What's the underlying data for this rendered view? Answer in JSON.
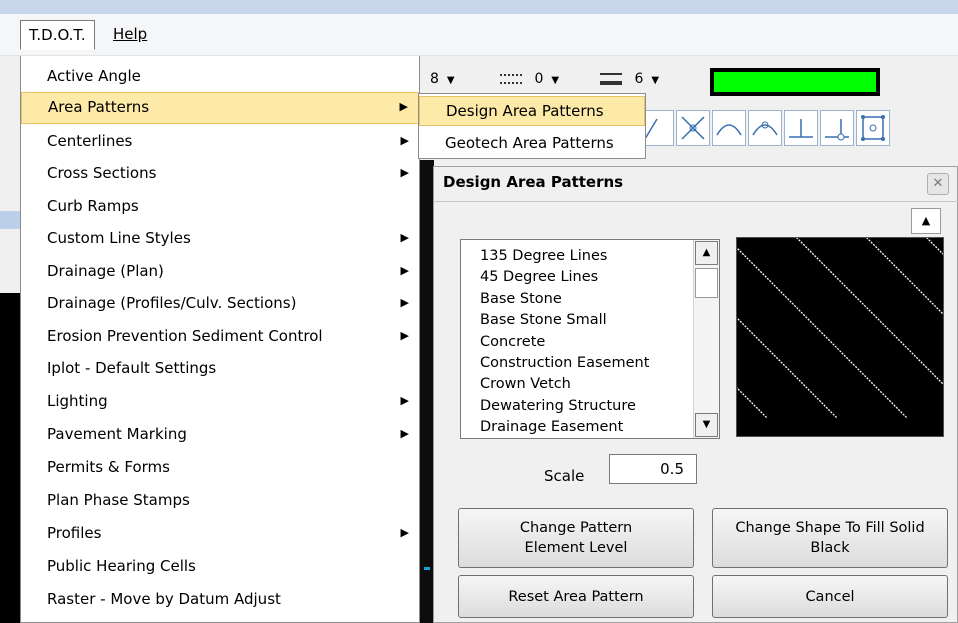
{
  "menubar": {
    "items": [
      {
        "label": "T.D.O.T."
      },
      {
        "label": "Help"
      }
    ]
  },
  "toolbar": {
    "weight_value": "8",
    "style_value": "0",
    "line_weight_value": "6",
    "active_color": "#00ff00"
  },
  "menu": {
    "items": [
      {
        "label": "Active Angle",
        "has_submenu": false
      },
      {
        "label": "Area Patterns",
        "has_submenu": true,
        "highlighted": true
      },
      {
        "label": "Centerlines",
        "has_submenu": true
      },
      {
        "label": "Cross Sections",
        "has_submenu": true
      },
      {
        "label": "Curb Ramps",
        "has_submenu": false
      },
      {
        "label": "Custom Line Styles",
        "has_submenu": true
      },
      {
        "label": "Drainage (Plan)",
        "has_submenu": true
      },
      {
        "label": "Drainage (Profiles/Culv. Sections)",
        "has_submenu": true
      },
      {
        "label": "Erosion Prevention Sediment Control",
        "has_submenu": true
      },
      {
        "label": "Iplot -  Default Settings",
        "has_submenu": false
      },
      {
        "label": "Lighting",
        "has_submenu": true
      },
      {
        "label": "Pavement Marking",
        "has_submenu": true
      },
      {
        "label": "Permits & Forms",
        "has_submenu": false
      },
      {
        "label": "Plan Phase Stamps",
        "has_submenu": false
      },
      {
        "label": "Profiles",
        "has_submenu": true
      },
      {
        "label": "Public Hearing Cells",
        "has_submenu": false
      },
      {
        "label": "Raster - Move by Datum Adjust",
        "has_submenu": false
      }
    ]
  },
  "submenu": {
    "items": [
      {
        "label": "Design Area Patterns",
        "highlighted": true
      },
      {
        "label": "Geotech Area Patterns",
        "highlighted": false
      }
    ]
  },
  "dialog": {
    "title": "Design  Area Patterns",
    "patterns": [
      "135 Degree Lines",
      "45 Degree Lines",
      "Base Stone",
      "Base Stone Small",
      "Concrete",
      "Construction Easement",
      "Crown Vetch",
      "Dewatering Structure",
      "Drainage Easement"
    ],
    "scale_label": "Scale",
    "scale_value": "0.5",
    "buttons": {
      "change_level": "Change Pattern Element Level",
      "fill_black": "Change Shape To Fill Solid Black",
      "reset": "Reset Area Pattern",
      "cancel": "Cancel"
    }
  }
}
